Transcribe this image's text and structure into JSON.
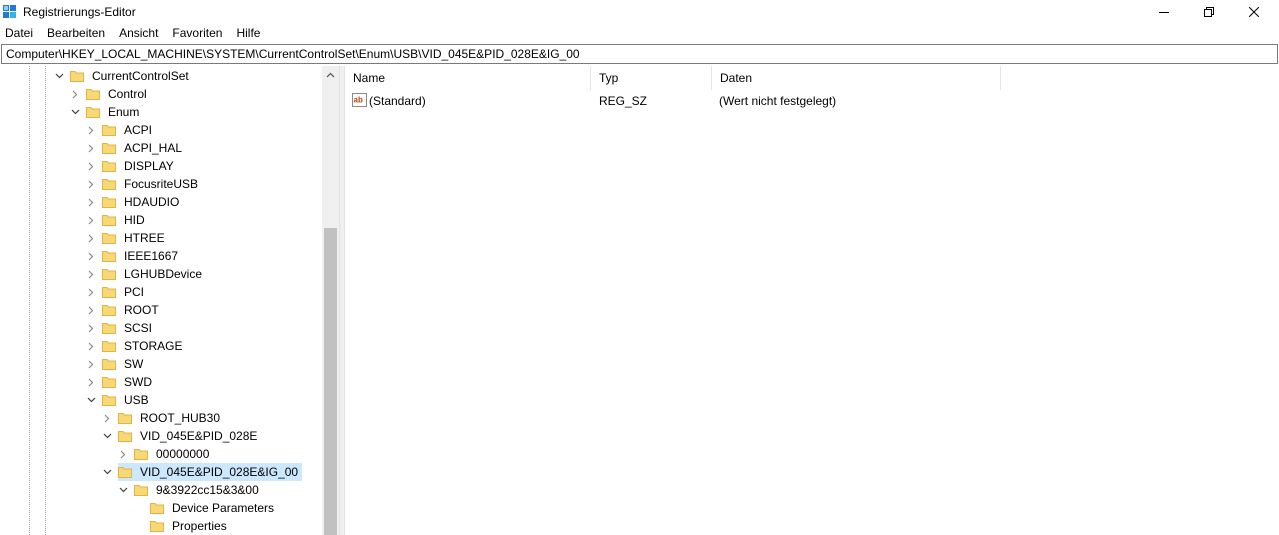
{
  "window": {
    "title": "Registrierungs-Editor",
    "app_icon": "regedit-icon",
    "controls": {
      "minimize": "minimize-icon",
      "maximize": "maximize-icon",
      "close": "close-icon"
    }
  },
  "menu": [
    "Datei",
    "Bearbeiten",
    "Ansicht",
    "Favoriten",
    "Hilfe"
  ],
  "address": "Computer\\HKEY_LOCAL_MACHINE\\SYSTEM\\CurrentControlSet\\Enum\\USB\\VID_045E&PID_028E&IG_00",
  "tree": {
    "nodes": [
      {
        "label": "CurrentControlSet",
        "depth": 0,
        "state": "expanded"
      },
      {
        "label": "Control",
        "depth": 1,
        "state": "collapsed"
      },
      {
        "label": "Enum",
        "depth": 1,
        "state": "expanded"
      },
      {
        "label": "ACPI",
        "depth": 2,
        "state": "collapsed"
      },
      {
        "label": "ACPI_HAL",
        "depth": 2,
        "state": "collapsed"
      },
      {
        "label": "DISPLAY",
        "depth": 2,
        "state": "collapsed"
      },
      {
        "label": "FocusriteUSB",
        "depth": 2,
        "state": "collapsed"
      },
      {
        "label": "HDAUDIO",
        "depth": 2,
        "state": "collapsed"
      },
      {
        "label": "HID",
        "depth": 2,
        "state": "collapsed"
      },
      {
        "label": "HTREE",
        "depth": 2,
        "state": "collapsed"
      },
      {
        "label": "IEEE1667",
        "depth": 2,
        "state": "collapsed"
      },
      {
        "label": "LGHUBDevice",
        "depth": 2,
        "state": "collapsed"
      },
      {
        "label": "PCI",
        "depth": 2,
        "state": "collapsed"
      },
      {
        "label": "ROOT",
        "depth": 2,
        "state": "collapsed"
      },
      {
        "label": "SCSI",
        "depth": 2,
        "state": "collapsed"
      },
      {
        "label": "STORAGE",
        "depth": 2,
        "state": "collapsed"
      },
      {
        "label": "SW",
        "depth": 2,
        "state": "collapsed"
      },
      {
        "label": "SWD",
        "depth": 2,
        "state": "collapsed"
      },
      {
        "label": "USB",
        "depth": 2,
        "state": "expanded"
      },
      {
        "label": "ROOT_HUB30",
        "depth": 3,
        "state": "collapsed"
      },
      {
        "label": "VID_045E&PID_028E",
        "depth": 3,
        "state": "expanded"
      },
      {
        "label": "00000000",
        "depth": 4,
        "state": "collapsed"
      },
      {
        "label": "VID_045E&PID_028E&IG_00",
        "depth": 3,
        "state": "expanded",
        "selected": true
      },
      {
        "label": "9&3922cc15&3&00",
        "depth": 4,
        "state": "expanded"
      },
      {
        "label": "Device Parameters",
        "depth": 5,
        "state": "leaf"
      },
      {
        "label": "Properties",
        "depth": 5,
        "state": "leaf"
      }
    ]
  },
  "list": {
    "columns": [
      "Name",
      "Typ",
      "Daten"
    ],
    "rows": [
      {
        "name": "(Standard)",
        "type": "REG_SZ",
        "data": "(Wert nicht festgelegt)",
        "icon": "string-value-icon"
      }
    ]
  },
  "colors": {
    "selection": "#cce8ff",
    "folder": "#f8d775",
    "folder_dark": "#e0b545",
    "scroll_thumb": "#c1c1c1",
    "scroll_track": "#f0f0f0"
  }
}
